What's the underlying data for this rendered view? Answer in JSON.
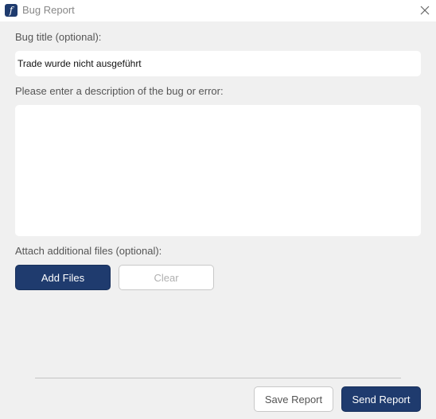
{
  "window": {
    "title": "Bug Report",
    "app_icon_glyph": "f",
    "accent_color": "#1f3b6e"
  },
  "form": {
    "title_label": "Bug title (optional):",
    "title_value": "Trade wurde nicht ausgeführt",
    "description_label": "Please enter a description of the bug or error:",
    "description_value": "",
    "attach_label": "Attach additional files (optional):"
  },
  "buttons": {
    "add_files": "Add Files",
    "clear": "Clear",
    "save_report": "Save Report",
    "send_report": "Send Report"
  },
  "icons": {
    "app": "app-logo-icon",
    "close": "close-icon"
  }
}
